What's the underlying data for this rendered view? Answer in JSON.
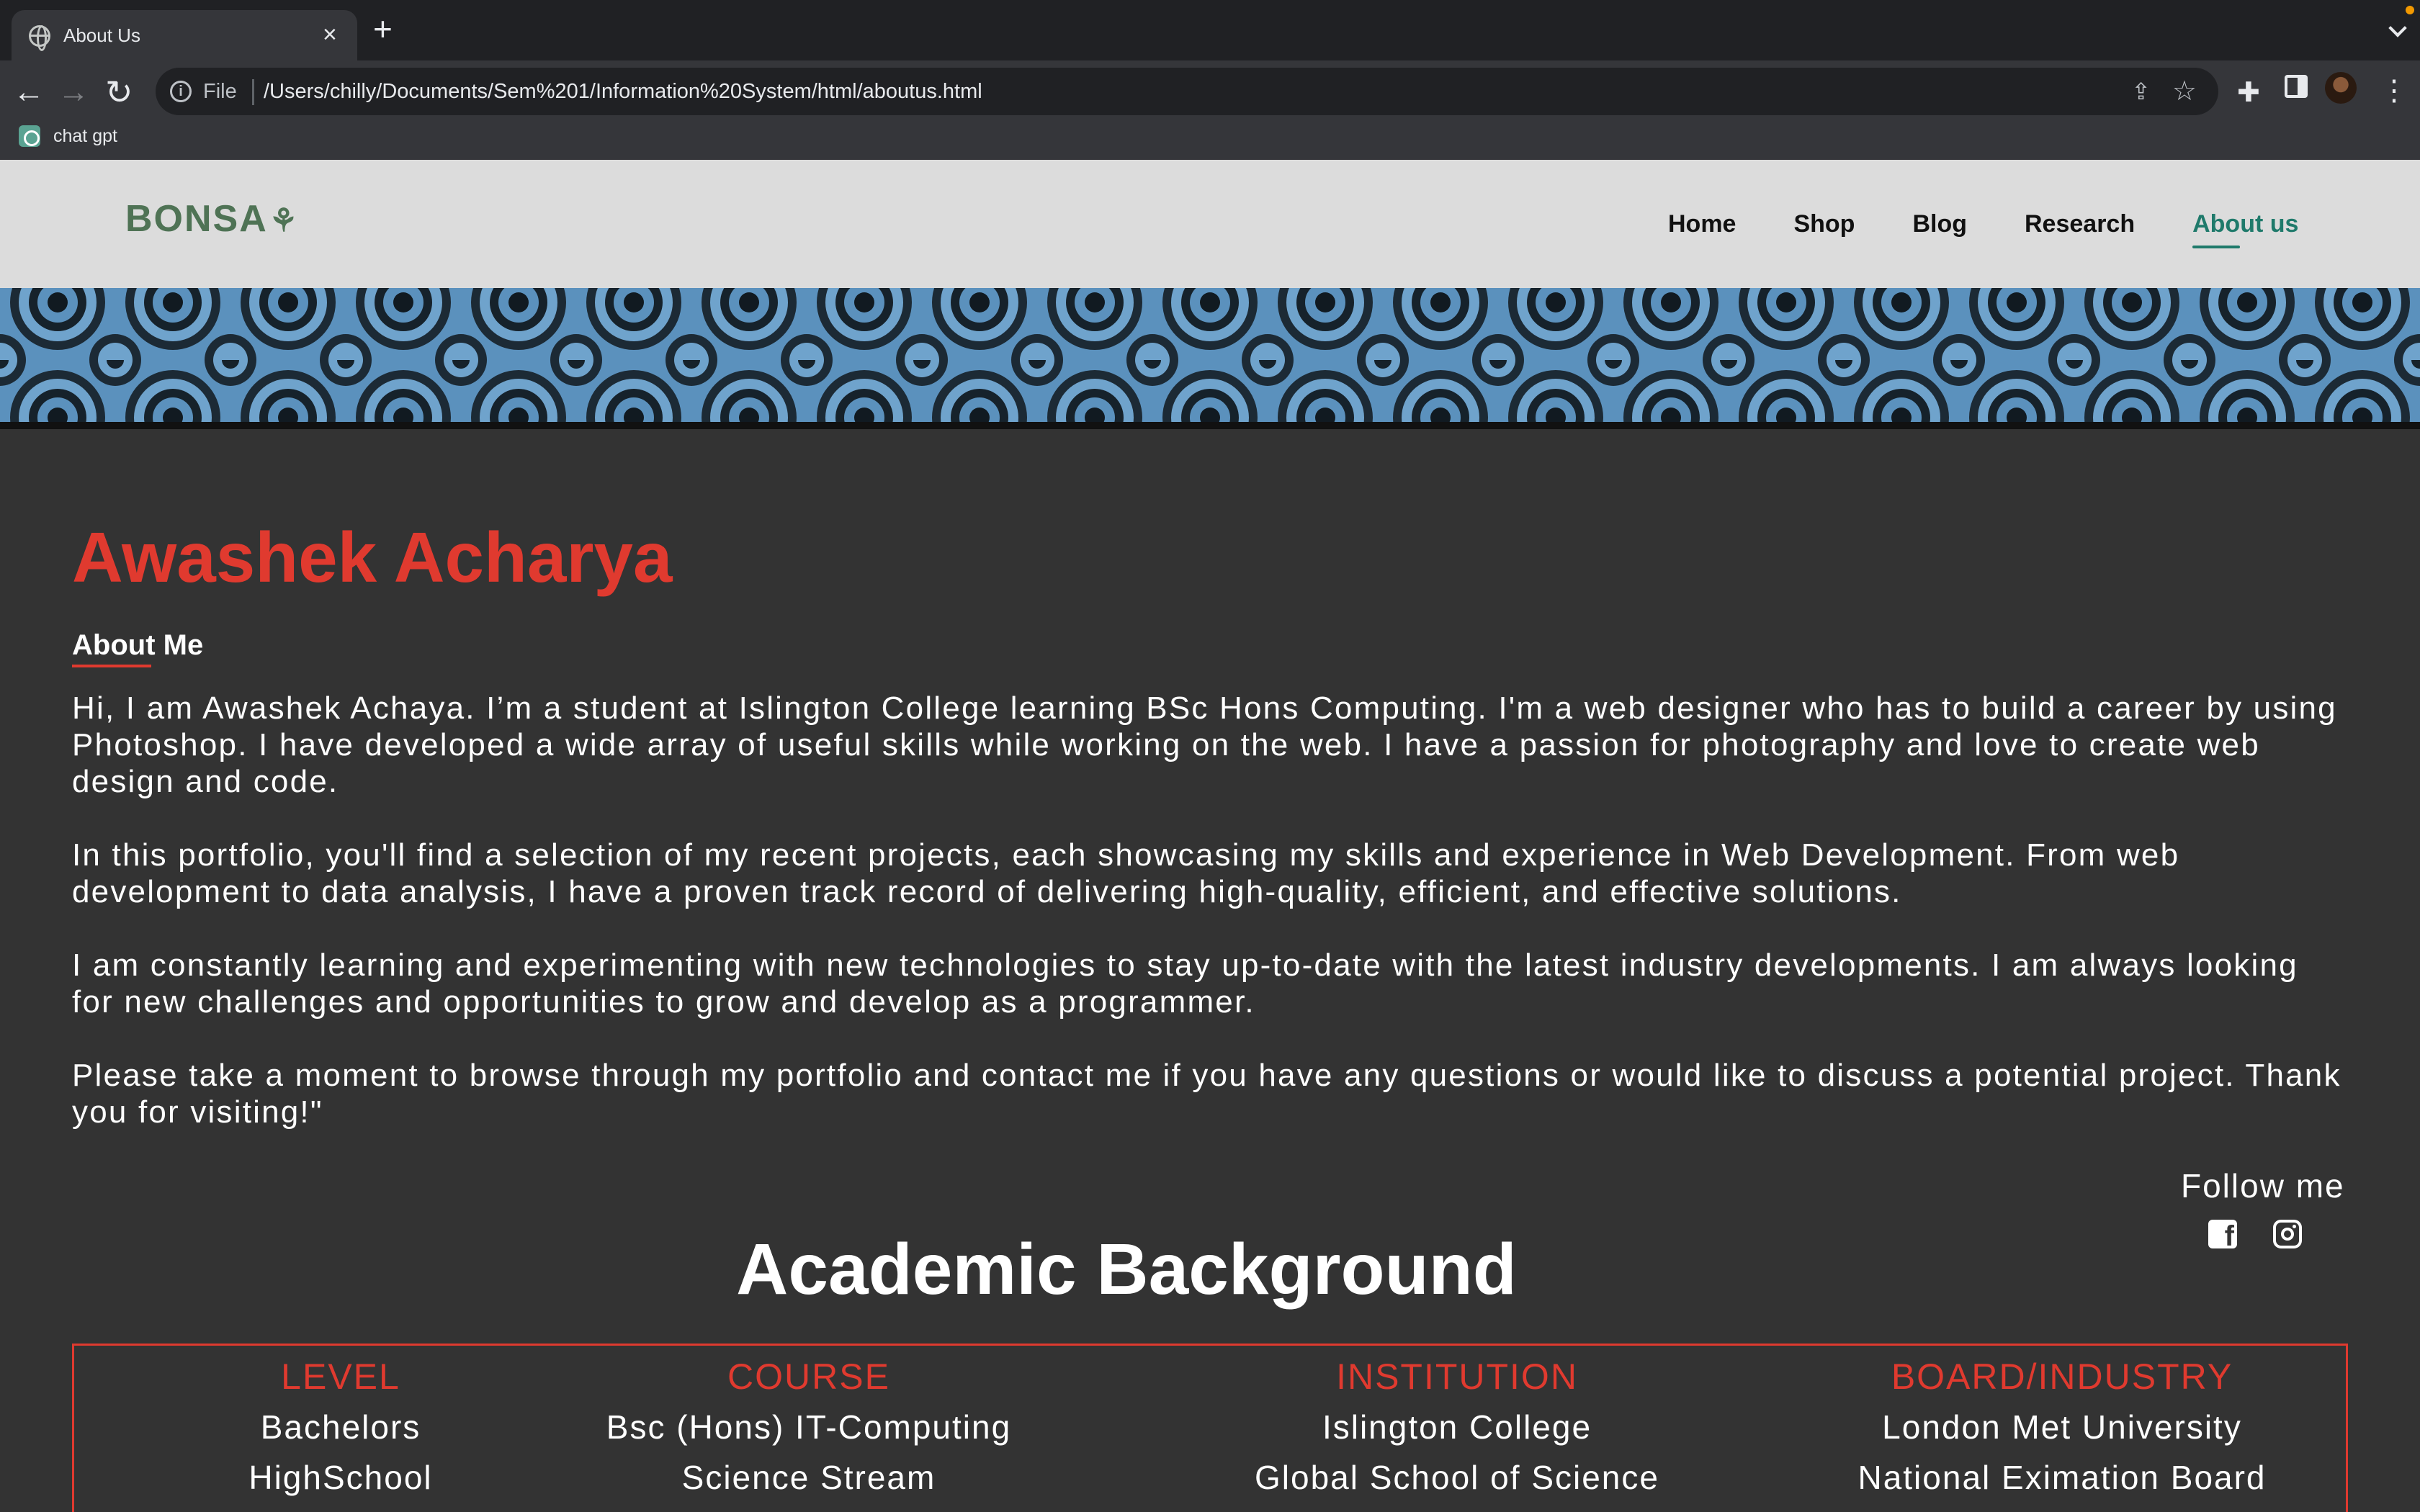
{
  "browser": {
    "tab_title": "About Us",
    "tab_close": "×",
    "new_tab": "+",
    "file_label": "File",
    "url": "/Users/chilly/Documents/Sem%201/Information%20System/html/aboutus.html",
    "bookmark_label": "chat gpt"
  },
  "site": {
    "logo_text": "BONSA",
    "nav": [
      "Home",
      "Shop",
      "Blog",
      "Research",
      "About us"
    ],
    "active_nav": "About us"
  },
  "profile": {
    "name": "Awashek Acharya",
    "about_heading": "About Me",
    "paragraphs": [
      "Hi, I am Awashek Achaya. I’m a student at Islington College learning BSc Hons Computing. I'm a web designer who has to build a career by using Photoshop. I have developed a wide array of useful skills while working on the web. I have a passion for photography and love to create web design and code.",
      "In this portfolio, you'll find a selection of my recent projects, each showcasing my skills and experience in Web Development. From web development to data analysis, I have a proven track record of delivering high-quality, efficient, and effective solutions.",
      "I am constantly learning and experimenting with new technologies to stay up-to-date with the latest industry developments. I am always looking for new challenges and opportunities to grow and develop as a programmer.",
      "Please take a moment to browse through my portfolio and contact me if you have any questions or would like to discuss a potential project. Thank you for visiting!\""
    ],
    "follow_label": "Follow me"
  },
  "academic": {
    "title": "Academic Background",
    "columns": [
      "LEVEL",
      "COURSE",
      "INSTITUTION",
      "BOARD/INDUSTRY"
    ],
    "rows": [
      [
        "Bachelors",
        "Bsc (Hons) IT-Computing",
        "Islington College",
        "London Met University"
      ],
      [
        "HighSchool",
        "Science Stream",
        "Global School of Science",
        "National Eximation Board"
      ]
    ]
  },
  "colors": {
    "accent_red": "#e03a2f",
    "nav_active": "#1f7a6b",
    "logo_green": "#4f7355",
    "page_bg": "#333333"
  }
}
